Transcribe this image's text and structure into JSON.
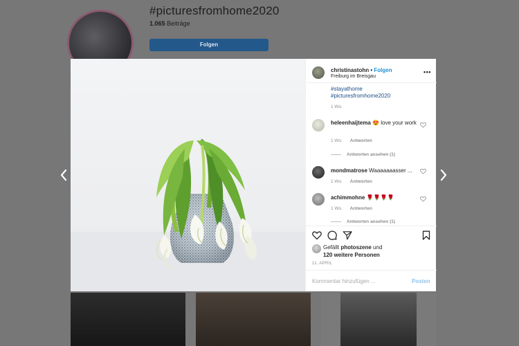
{
  "profile": {
    "hashtag": "#picturesfromhome2020",
    "post_count": "1.065",
    "post_count_label": "Beiträge",
    "follow_button": "Folgen"
  },
  "post": {
    "username": "christinastohn",
    "separator": "•",
    "follow_link": "Folgen",
    "location": "Freiburg im Breisgau",
    "caption_tags": [
      "#stayathome",
      "#picturesfromhome2020"
    ],
    "caption_age": "1 Wo.",
    "comments": [
      {
        "user": "heleenhaijtema",
        "emoji": "😍",
        "text": "love your work",
        "age": "1 Wo.",
        "reply": "Antworten",
        "view_replies": "Antworten ansehen (1)"
      },
      {
        "user": "mondmatrose",
        "text": "Waaaaaaasser",
        "ellipsis": "...",
        "age": "1 Wo.",
        "reply": "Antworten"
      },
      {
        "user": "achimmohne",
        "text": "🌹🌹🌹🌹",
        "age": "1 Wo.",
        "reply": "Antworten",
        "view_replies": "Antworten ansehen (1)"
      }
    ],
    "likes": {
      "prefix": "Gefällt",
      "user": "photoszene",
      "connector": "und",
      "others": "120 weitere Personen"
    },
    "date": "11. APRIL",
    "comment_placeholder": "Kommentar hinzufügen ...",
    "post_button": "Posten"
  },
  "icons": {
    "more": "more-options-icon",
    "heart": "heart-icon",
    "comment": "comment-icon",
    "share": "share-icon",
    "save": "bookmark-icon",
    "prev": "chevron-left-icon",
    "next": "chevron-right-icon"
  },
  "colors": {
    "accent": "#0095f6",
    "link": "#1a92d8",
    "hashtag": "#1b4e86",
    "overlay": "#777777",
    "bg_follow_button": "#23588a",
    "muted": "#8e8e8e"
  }
}
